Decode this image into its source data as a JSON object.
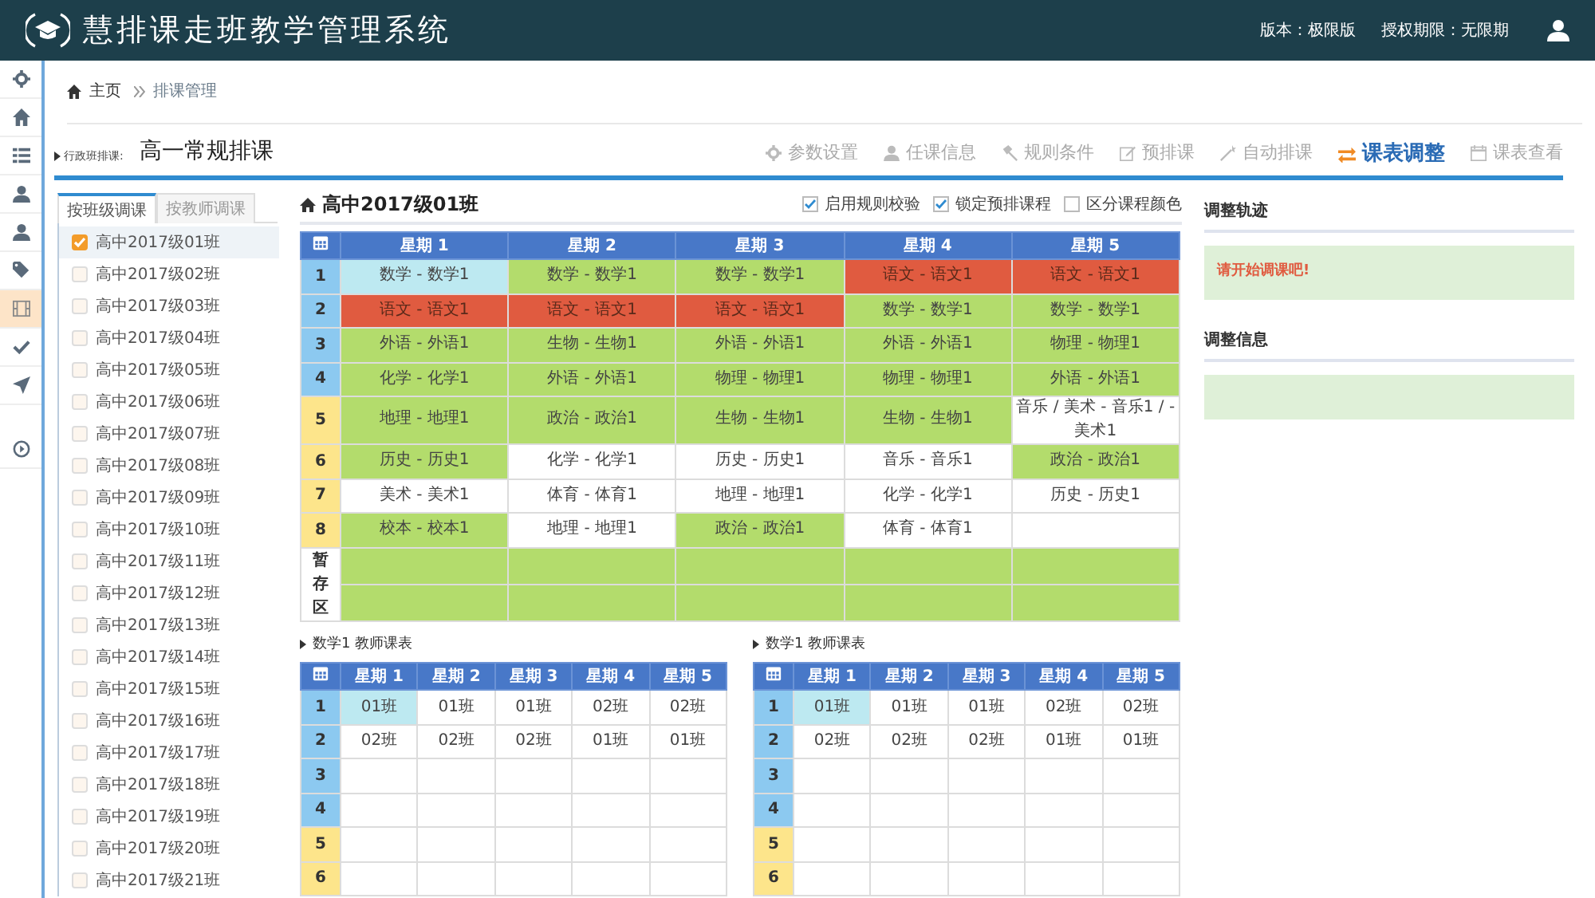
{
  "app": {
    "title": "慧排课走班教学管理系统",
    "version": "版本：极限版",
    "license": "授权期限：无限期"
  },
  "side_nav": [
    {
      "selected": false
    },
    {
      "selected": false
    },
    {
      "selected": false
    },
    {
      "selected": false
    },
    {
      "selected": false
    },
    {
      "selected": false
    },
    {
      "selected": true
    },
    {
      "selected": false
    },
    {
      "selected": false
    },
    {
      "selected": false
    }
  ],
  "breadcrumb": [
    "主页",
    "排课管理"
  ],
  "page": {
    "label": "行政班排课:",
    "title": "高一常规排课"
  },
  "steps": [
    {
      "label": "参数设置",
      "selected": false
    },
    {
      "label": "任课信息",
      "selected": false
    },
    {
      "label": "规则条件",
      "selected": false
    },
    {
      "label": "预排课",
      "selected": false
    },
    {
      "label": "自动排课",
      "selected": false
    },
    {
      "label": "课表调整",
      "selected": true
    },
    {
      "label": "课表查看",
      "selected": false
    }
  ],
  "tabs": [
    {
      "label": "按班级调课",
      "selected": true
    },
    {
      "label": "按教师调课",
      "selected": false
    }
  ],
  "classes": [
    {
      "label": "高中2017级01班",
      "checked": true
    },
    {
      "label": "高中2017级02班",
      "checked": false
    },
    {
      "label": "高中2017级03班",
      "checked": false
    },
    {
      "label": "高中2017级04班",
      "checked": false
    },
    {
      "label": "高中2017级05班",
      "checked": false
    },
    {
      "label": "高中2017级06班",
      "checked": false
    },
    {
      "label": "高中2017级07班",
      "checked": false
    },
    {
      "label": "高中2017级08班",
      "checked": false
    },
    {
      "label": "高中2017级09班",
      "checked": false
    },
    {
      "label": "高中2017级10班",
      "checked": false
    },
    {
      "label": "高中2017级11班",
      "checked": false
    },
    {
      "label": "高中2017级12班",
      "checked": false
    },
    {
      "label": "高中2017级13班",
      "checked": false
    },
    {
      "label": "高中2017级14班",
      "checked": false
    },
    {
      "label": "高中2017级15班",
      "checked": false
    },
    {
      "label": "高中2017级16班",
      "checked": false
    },
    {
      "label": "高中2017级17班",
      "checked": false
    },
    {
      "label": "高中2017级18班",
      "checked": false
    },
    {
      "label": "高中2017级19班",
      "checked": false
    },
    {
      "label": "高中2017级20班",
      "checked": false
    },
    {
      "label": "高中2017级21班",
      "checked": false
    }
  ],
  "timetable": {
    "title": "高中2017级01班",
    "options": [
      {
        "label": "启用规则校验",
        "checked": true
      },
      {
        "label": "锁定预排课程",
        "checked": true
      },
      {
        "label": "区分课程颜色",
        "checked": false
      }
    ],
    "columns": [
      "星期 1",
      "星期 2",
      "星期 3",
      "星期 4",
      "星期 5"
    ],
    "rows": [
      {
        "period": "1",
        "kind": "am",
        "cells": [
          {
            "text": "数学 - 数学1",
            "color": "#bde9f1"
          },
          {
            "text": "数学 - 数学1",
            "color": "#b3dc6c"
          },
          {
            "text": "数学 - 数学1",
            "color": "#b3dc6c"
          },
          {
            "text": "语文 - 语文1",
            "color": "#e05b40"
          },
          {
            "text": "语文 - 语文1",
            "color": "#e05b40"
          }
        ]
      },
      {
        "period": "2",
        "kind": "am",
        "cells": [
          {
            "text": "语文 - 语文1",
            "color": "#e05b40"
          },
          {
            "text": "语文 - 语文1",
            "color": "#e05b40"
          },
          {
            "text": "语文 - 语文1",
            "color": "#e05b40"
          },
          {
            "text": "数学 - 数学1",
            "color": "#b3dc6c"
          },
          {
            "text": "数学 - 数学1",
            "color": "#b3dc6c"
          }
        ]
      },
      {
        "period": "3",
        "kind": "am",
        "cells": [
          {
            "text": "外语 - 外语1",
            "color": "#b3dc6c"
          },
          {
            "text": "生物 - 生物1",
            "color": "#b3dc6c"
          },
          {
            "text": "外语 - 外语1",
            "color": "#b3dc6c"
          },
          {
            "text": "外语 - 外语1",
            "color": "#b3dc6c"
          },
          {
            "text": "物理 - 物理1",
            "color": "#b3dc6c"
          }
        ]
      },
      {
        "period": "4",
        "kind": "am",
        "cells": [
          {
            "text": "化学 - 化学1",
            "color": "#b3dc6c"
          },
          {
            "text": "外语 - 外语1",
            "color": "#b3dc6c"
          },
          {
            "text": "物理 - 物理1",
            "color": "#b3dc6c"
          },
          {
            "text": "物理 - 物理1",
            "color": "#b3dc6c"
          },
          {
            "text": "外语 - 外语1",
            "color": "#b3dc6c"
          }
        ]
      },
      {
        "period": "5",
        "kind": "pm",
        "cells": [
          {
            "text": "地理 - 地理1",
            "color": "#b3dc6c"
          },
          {
            "text": "政治 - 政治1",
            "color": "#b3dc6c"
          },
          {
            "text": "生物 - 生物1",
            "color": "#b3dc6c"
          },
          {
            "text": "生物 - 生物1",
            "color": "#b3dc6c"
          },
          {
            "text": "音乐 / 美术 - 音乐1 / - 美术1",
            "color": "#ffffff"
          }
        ]
      },
      {
        "period": "6",
        "kind": "pm",
        "cells": [
          {
            "text": "历史 - 历史1",
            "color": "#b3dc6c"
          },
          {
            "text": "化学 - 化学1",
            "color": "#ffffff"
          },
          {
            "text": "历史 - 历史1",
            "color": "#ffffff"
          },
          {
            "text": "音乐 - 音乐1",
            "color": "#ffffff"
          },
          {
            "text": "政治 - 政治1",
            "color": "#b3dc6c"
          }
        ]
      },
      {
        "period": "7",
        "kind": "pm",
        "cells": [
          {
            "text": "美术 - 美术1",
            "color": "#ffffff"
          },
          {
            "text": "体育 - 体育1",
            "color": "#ffffff"
          },
          {
            "text": "地理 - 地理1",
            "color": "#ffffff"
          },
          {
            "text": "化学 - 化学1",
            "color": "#ffffff"
          },
          {
            "text": "历史 - 历史1",
            "color": "#ffffff"
          }
        ]
      },
      {
        "period": "8",
        "kind": "pm",
        "cells": [
          {
            "text": "校本 - 校本1",
            "color": "#b3dc6c"
          },
          {
            "text": "地理 - 地理1",
            "color": "#ffffff"
          },
          {
            "text": "政治 - 政治1",
            "color": "#b3dc6c"
          },
          {
            "text": "体育 - 体育1",
            "color": "#ffffff"
          },
          {
            "color": "#ffffff"
          }
        ]
      }
    ],
    "holding": {
      "label": "暂存区",
      "rows": [
        {
          "cells": [
            {
              "color": "#b3dc6c"
            },
            {
              "color": "#b3dc6c"
            },
            {
              "color": "#b3dc6c"
            },
            {
              "color": "#b3dc6c"
            },
            {
              "color": "#b3dc6c"
            }
          ]
        },
        {
          "cells": [
            {
              "color": "#b3dc6c"
            },
            {
              "color": "#b3dc6c"
            },
            {
              "color": "#b3dc6c"
            },
            {
              "color": "#b3dc6c"
            },
            {
              "color": "#b3dc6c"
            }
          ]
        }
      ]
    }
  },
  "teacher_tables": [
    {
      "title": "数学1 教师课表",
      "columns": [
        "星期 1",
        "星期 2",
        "星期 3",
        "星期 4",
        "星期 5"
      ],
      "rows": [
        {
          "period": "1",
          "kind": "am",
          "cells": [
            {
              "text": "01班",
              "selected": true
            },
            {
              "text": "01班",
              "selected": false
            },
            {
              "text": "01班",
              "selected": false
            },
            {
              "text": "02班",
              "selected": false
            },
            {
              "text": "02班",
              "selected": false
            }
          ]
        },
        {
          "period": "2",
          "kind": "am",
          "cells": [
            {
              "text": "02班",
              "selected": false
            },
            {
              "text": "02班",
              "selected": false
            },
            {
              "text": "02班",
              "selected": false
            },
            {
              "text": "01班",
              "selected": false
            },
            {
              "text": "01班",
              "selected": false
            }
          ]
        },
        {
          "period": "3",
          "kind": "am",
          "cells": [
            {
              "selected": false
            },
            {
              "selected": false
            },
            {
              "selected": false
            },
            {
              "selected": false
            },
            {
              "selected": false
            }
          ]
        },
        {
          "period": "4",
          "kind": "am",
          "cells": [
            {
              "selected": false
            },
            {
              "selected": false
            },
            {
              "selected": false
            },
            {
              "selected": false
            },
            {
              "selected": false
            }
          ]
        },
        {
          "period": "5",
          "kind": "pm",
          "cells": [
            {
              "selected": false
            },
            {
              "selected": false
            },
            {
              "selected": false
            },
            {
              "selected": false
            },
            {
              "selected": false
            }
          ]
        },
        {
          "period": "6",
          "kind": "pm",
          "cells": [
            {
              "selected": false
            },
            {
              "selected": false
            },
            {
              "selected": false
            },
            {
              "selected": false
            },
            {
              "selected": false
            }
          ]
        }
      ]
    },
    {
      "title": "数学1 教师课表",
      "columns": [
        "星期 1",
        "星期 2",
        "星期 3",
        "星期 4",
        "星期 5"
      ],
      "rows": [
        {
          "period": "1",
          "kind": "am",
          "cells": [
            {
              "text": "01班",
              "selected": true
            },
            {
              "text": "01班",
              "selected": false
            },
            {
              "text": "01班",
              "selected": false
            },
            {
              "text": "02班",
              "selected": false
            },
            {
              "text": "02班",
              "selected": false
            }
          ]
        },
        {
          "period": "2",
          "kind": "am",
          "cells": [
            {
              "text": "02班",
              "selected": false
            },
            {
              "text": "02班",
              "selected": false
            },
            {
              "text": "02班",
              "selected": false
            },
            {
              "text": "01班",
              "selected": false
            },
            {
              "text": "01班",
              "selected": false
            }
          ]
        },
        {
          "period": "3",
          "kind": "am",
          "cells": [
            {
              "selected": false
            },
            {
              "selected": false
            },
            {
              "selected": false
            },
            {
              "selected": false
            },
            {
              "selected": false
            }
          ]
        },
        {
          "period": "4",
          "kind": "am",
          "cells": [
            {
              "selected": false
            },
            {
              "selected": false
            },
            {
              "selected": false
            },
            {
              "selected": false
            },
            {
              "selected": false
            }
          ]
        },
        {
          "period": "5",
          "kind": "pm",
          "cells": [
            {
              "selected": false
            },
            {
              "selected": false
            },
            {
              "selected": false
            },
            {
              "selected": false
            },
            {
              "selected": false
            }
          ]
        },
        {
          "period": "6",
          "kind": "pm",
          "cells": [
            {
              "selected": false
            },
            {
              "selected": false
            },
            {
              "selected": false
            },
            {
              "selected": false
            },
            {
              "selected": false
            }
          ]
        }
      ]
    }
  ],
  "adjust": {
    "track_title": "调整轨迹",
    "track_message": "请开始调课吧!",
    "info_title": "调整信息"
  }
}
